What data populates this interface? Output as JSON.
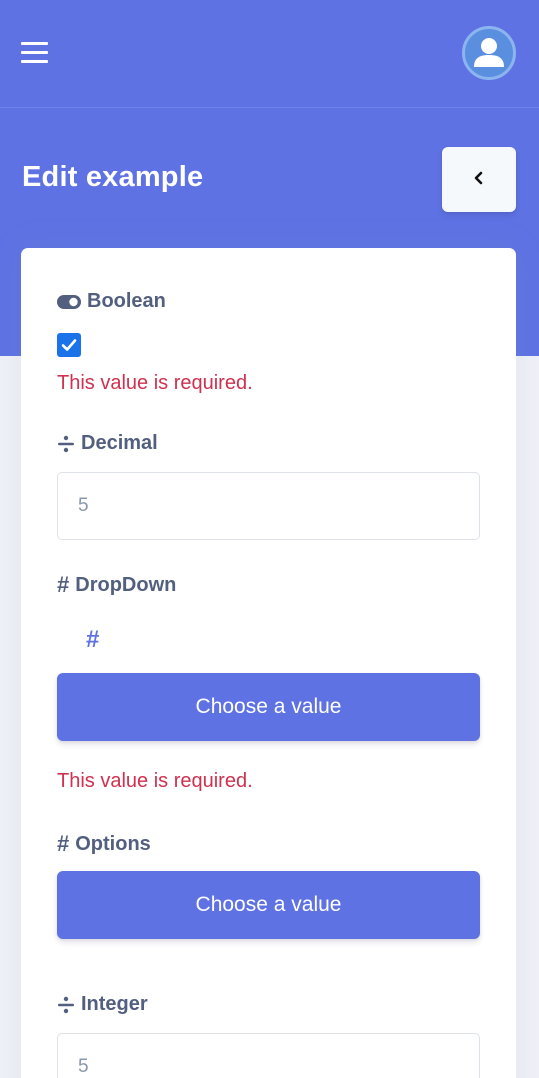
{
  "header": {
    "menu_icon": "hamburger-menu-icon",
    "avatar_icon": "user-avatar-icon"
  },
  "page": {
    "title": "Edit example",
    "back_icon": "chevron-left-icon"
  },
  "form": {
    "boolean": {
      "label": "Boolean",
      "icon": "toggle-icon",
      "checked": true,
      "error": "This value is required."
    },
    "decimal": {
      "label": "Decimal",
      "icon": "divide-icon",
      "value": "5"
    },
    "dropdown": {
      "label": "DropDown",
      "icon_glyph": "#",
      "accent_glyph": "#",
      "button_label": "Choose a value",
      "error": "This value is required."
    },
    "options": {
      "label": "Options",
      "icon_glyph": "#",
      "button_label": "Choose a value"
    },
    "integer": {
      "label": "Integer",
      "icon": "divide-icon",
      "value": "5"
    }
  },
  "colors": {
    "primary": "#5e72e4",
    "error": "#d0314f",
    "label": "#525f7f"
  }
}
